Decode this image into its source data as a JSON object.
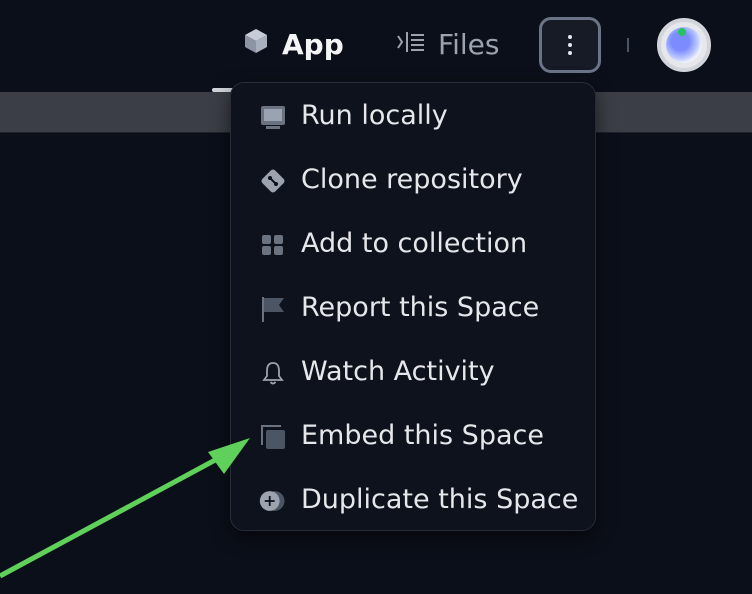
{
  "header": {
    "tabs": [
      {
        "label": "App",
        "icon": "cube-icon",
        "active": true
      },
      {
        "label": "Files",
        "icon": "files-icon",
        "active": false
      }
    ],
    "more_button_icon": "kebab-menu-icon",
    "avatar_icon": "user-avatar"
  },
  "menu": {
    "items": [
      {
        "label": "Run locally",
        "icon": "terminal-icon"
      },
      {
        "label": "Clone repository",
        "icon": "git-icon"
      },
      {
        "label": "Add to collection",
        "icon": "collection-icon"
      },
      {
        "label": "Report this Space",
        "icon": "flag-icon"
      },
      {
        "label": "Watch Activity",
        "icon": "bell-icon"
      },
      {
        "label": "Embed this Space",
        "icon": "embed-icon"
      },
      {
        "label": "Duplicate this Space",
        "icon": "duplicate-icon"
      }
    ]
  },
  "annotation": {
    "arrow_color": "#5fd15a",
    "points_to": "Embed this Space"
  },
  "colors": {
    "background": "#0b0f19",
    "menu_background": "#0d121c",
    "text": "#e5e7eb",
    "muted_text": "#9ca3af",
    "strip": "#3b3e46"
  }
}
